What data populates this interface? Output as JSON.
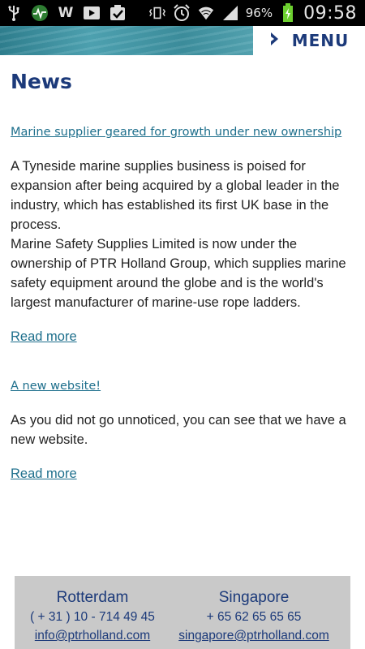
{
  "statusbar": {
    "left_icons": [
      "usb-icon",
      "activity-icon",
      "w-icon",
      "youtube-icon",
      "task-check-icon"
    ],
    "w_glyph": "W",
    "battery_percent": "96%",
    "time": "09:58"
  },
  "header": {
    "menu_label": "MENU"
  },
  "main": {
    "page_title": "News",
    "articles": [
      {
        "title": "Marine supplier geared for growth under new ownership",
        "body_p1": "A Tyneside marine supplies business is poised for expansion after being acquired by a global leader in the industry, which has established its first UK base in the process.",
        "body_p2": "Marine Safety Supplies Limited is now under the ownership of PTR Holland Group, which supplies marine safety equipment around the globe and is the world's largest manufacturer of marine-use rope ladders.",
        "read_more": "Read more"
      },
      {
        "title": "A new website!",
        "body_p1": "As you did not go unnoticed, you can see that we have a new website.",
        "read_more": "Read more"
      }
    ]
  },
  "footer": {
    "offices": [
      {
        "city": "Rotterdam",
        "phone": "( + 31 ) 10 - 714 49 45",
        "email": "info@ptrholland.com"
      },
      {
        "city": "Singapore",
        "phone": "+ 65 62 65 65 65",
        "email": "singapore@ptrholland.com"
      }
    ]
  },
  "colors": {
    "accent": "#1c3a7a",
    "link": "#1e6f8c",
    "footer_bg": "#c9c9c9"
  }
}
